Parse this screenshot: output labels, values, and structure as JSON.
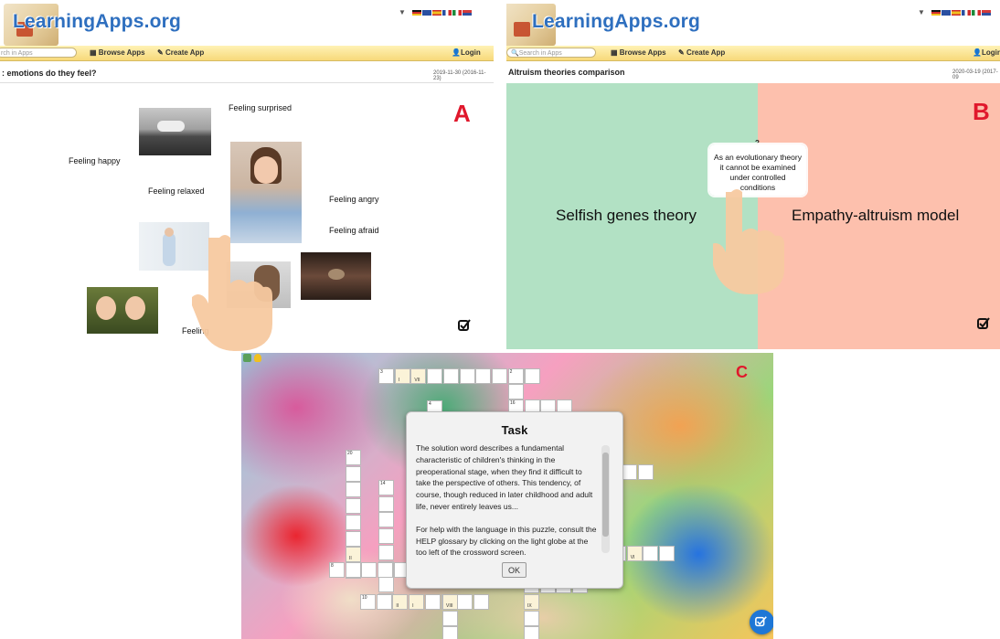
{
  "common": {
    "logo_text": "LearningApps.org",
    "search_placeholder": "Search in Apps",
    "browse_label": "Browse Apps",
    "create_label": "Create App",
    "login_label": "Login",
    "flag_colors": [
      "#d42c2c",
      "#f0c020",
      "#2a4fa0",
      "#cf2a2a",
      "#e8b020",
      "#1d8a3a",
      "#d72a2a",
      "#3050a0",
      "#d43a3a"
    ]
  },
  "panel_a": {
    "search_placeholder": "rch in Apps",
    "title": ": emotions do they feel?",
    "date": "2019-11-30 (2016-11-23)",
    "letter": "A",
    "labels": [
      "Feeling surprised",
      "Feeling happy",
      "Feeling relaxed",
      "Feeling angry",
      "Feeling afraid",
      "Feeling"
    ]
  },
  "panel_b": {
    "title": "Altruism theories comparison",
    "date": "2020-03-19 (2017-09",
    "letter": "B",
    "left_label": "Selfish genes theory",
    "right_label": "Empathy-altruism model",
    "card_mark": "?",
    "card_text": "As an evolutionary theory it cannot be examined under controlled conditions",
    "left_color": "#b2e1c4",
    "right_color": "#fdc0ad"
  },
  "panel_c": {
    "letter": "C",
    "task_title": "Task",
    "task_paragraph_1": "The solution word describes a fundamental characteristic of children's thinking in the preoperational stage, when they find it difficult to take the perspective of others. This tendency, of course, though reduced in later childhood and adult life, never entirely leaves us...",
    "task_paragraph_2": "For help with the language in this puzzle, consult the HELP glossary by clicking on the light globe at the too left of the crossword screen.",
    "ok_label": "OK",
    "clue_numbers": [
      "3",
      "2",
      "4",
      "16",
      "20",
      "14",
      "8",
      "10",
      "9"
    ],
    "cell_marks": [
      "I",
      "VII",
      "II",
      "III",
      "VIII",
      "I",
      "II",
      "VI",
      "IX"
    ]
  }
}
